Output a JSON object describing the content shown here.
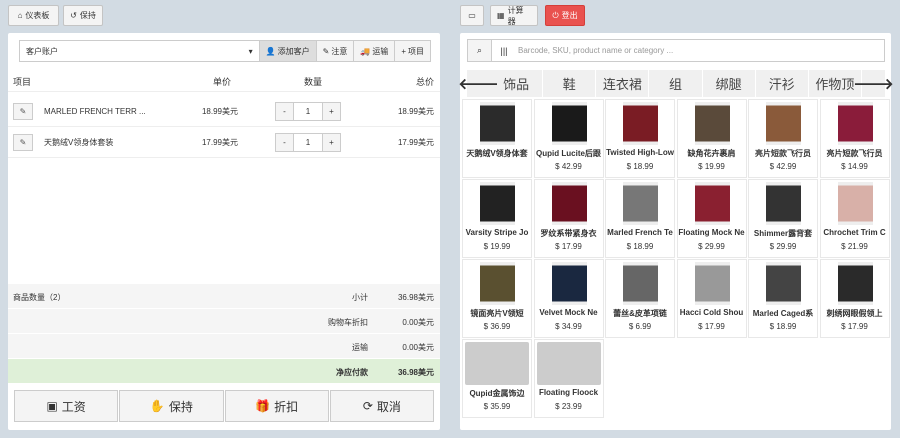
{
  "top": {
    "dashboard": "仪表板",
    "hold": "保持",
    "calculator": "计算器",
    "logout": "登出"
  },
  "customer": {
    "account": "客户账户",
    "add_customer": "添加客户",
    "note": "注意",
    "shipping": "运输",
    "item": "项目"
  },
  "table": {
    "h_item": "项目",
    "h_price": "单价",
    "h_qty": "数量",
    "h_total": "总价",
    "rows": [
      {
        "name": "MARLED FRENCH TERR ...",
        "price": "18.99美元",
        "qty": "1",
        "total": "18.99美元"
      },
      {
        "name": "天鹅绒V领身体套装",
        "price": "17.99美元",
        "qty": "1",
        "total": "17.99美元"
      }
    ]
  },
  "summary": {
    "count_label": "商品数量（2）",
    "subtotal_label": "小计",
    "subtotal": "36.98美元",
    "discount_label": "购物车折扣",
    "discount": "0.00美元",
    "shipping_label": "运输",
    "shipping": "0.00美元",
    "net_label": "净应付款",
    "net": "36.98美元"
  },
  "actions": {
    "pay": "工资",
    "hold": "保持",
    "discount": "折扣",
    "cancel": "取消"
  },
  "search": {
    "placeholder": "Barcode, SKU, product name or category ..."
  },
  "categories": [
    "饰品",
    "鞋",
    "连衣裙",
    "组",
    "绑腿",
    "汗衫",
    "作物顶"
  ],
  "products": [
    {
      "name": "天鹅绒V领身体套",
      "price": "",
      "color": "#2b2b2b"
    },
    {
      "name": "Qupid Lucite后跟",
      "price": "$ 42.99",
      "color": "#1a1a1a"
    },
    {
      "name": "Twisted High-Low",
      "price": "$ 18.99",
      "color": "#7a1c24"
    },
    {
      "name": "缺角花卉裹肩",
      "price": "$ 19.99",
      "color": "#5a4a3a"
    },
    {
      "name": "亮片短款飞行员",
      "price": "$ 42.99",
      "color": "#8a5a3a"
    },
    {
      "name": "亮片短款飞行员",
      "price": "$ 14.99",
      "color": "#8a1c3a"
    },
    {
      "name": "Varsity Stripe Jo",
      "price": "$ 19.99",
      "color": "#222222"
    },
    {
      "name": "罗纹系带紧身衣",
      "price": "$ 17.99",
      "color": "#6a1020"
    },
    {
      "name": "Marled French Te",
      "price": "$ 18.99",
      "color": "#777777"
    },
    {
      "name": "Floating Mock Ne",
      "price": "$ 29.99",
      "color": "#8a2030"
    },
    {
      "name": "Shimmer露背套",
      "price": "$ 29.99",
      "color": "#333333"
    },
    {
      "name": "Chrochet Trim C",
      "price": "$ 21.99",
      "color": "#d8b0a8"
    },
    {
      "name": "镜面亮片V领短",
      "price": "$ 36.99",
      "color": "#5a5030"
    },
    {
      "name": "Velvet Mock Ne",
      "price": "$ 34.99",
      "color": "#1a2840"
    },
    {
      "name": "蕾丝&皮革项链",
      "price": "$ 6.99",
      "color": "#666666"
    },
    {
      "name": "Hacci Cold Shou",
      "price": "$ 17.99",
      "color": "#999999"
    },
    {
      "name": "Marled Caged系",
      "price": "$ 18.99",
      "color": "#444444"
    },
    {
      "name": "刺绣网眼假领上",
      "price": "$ 17.99",
      "color": "#2a2a2a"
    },
    {
      "name": "Qupid金属饰边",
      "price": "$ 35.99",
      "color": ""
    },
    {
      "name": "Floating Floock",
      "price": "$ 23.99",
      "color": ""
    }
  ]
}
